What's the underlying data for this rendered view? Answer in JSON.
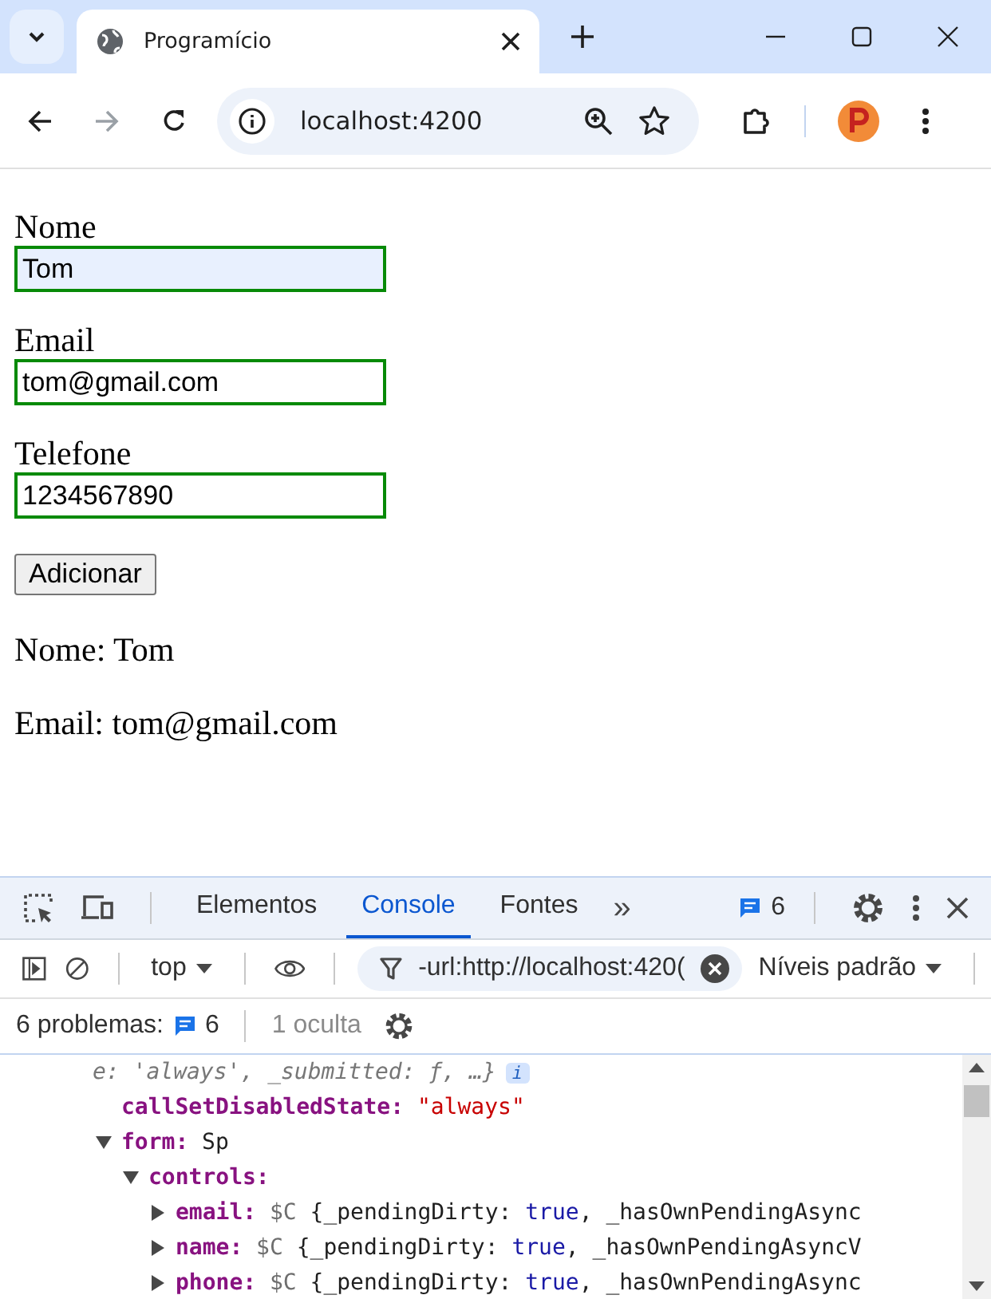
{
  "browser": {
    "tab_title": "Programício",
    "url": "localhost:4200"
  },
  "form": {
    "fields": [
      {
        "label": "Nome",
        "value": "Tom",
        "autofilled": true
      },
      {
        "label": "Email",
        "value": "tom@gmail.com",
        "autofilled": false
      },
      {
        "label": "Telefone",
        "value": "1234567890",
        "autofilled": false
      }
    ],
    "submit_button": "Adicionar",
    "results": [
      "Nome: Tom",
      "Email: tom@gmail.com"
    ]
  },
  "devtools": {
    "tabs": [
      {
        "label": "Elementos",
        "selected": false
      },
      {
        "label": "Console",
        "selected": true
      },
      {
        "label": "Fontes",
        "selected": false
      }
    ],
    "more_tabs": "»",
    "issues_count": "6",
    "context": "top",
    "filter": "-url:http://localhost:420(",
    "levels": "Níveis padrão",
    "problems_label": "6 problemas:",
    "problems_count": "6",
    "hidden": "1 oculta",
    "console": [
      {
        "kind": "summary",
        "text": "e: 'always', _submitted: ƒ, …}",
        "badge": "i"
      },
      {
        "kind": "prop",
        "key": "callSetDisabledState:",
        "value": "\"always\""
      },
      {
        "kind": "node",
        "key": "form:",
        "expanded": true,
        "segments": [
          {
            "kind": "plain",
            "t": "Sp"
          }
        ],
        "children": [
          {
            "kind": "node",
            "key": "controls:",
            "expanded": true,
            "children": [
              {
                "kind": "node",
                "key": "email:",
                "expanded": false,
                "segments": [
                  {
                    "kind": "type",
                    "t": "$C "
                  },
                  {
                    "kind": "plain",
                    "t": "{_pendingDirty: "
                  },
                  {
                    "kind": "bool",
                    "t": "true"
                  },
                  {
                    "kind": "plain",
                    "t": ", _hasOwnPendingAsync"
                  }
                ]
              },
              {
                "kind": "node",
                "key": "name:",
                "expanded": false,
                "segments": [
                  {
                    "kind": "type",
                    "t": "$C "
                  },
                  {
                    "kind": "plain",
                    "t": "{_pendingDirty: "
                  },
                  {
                    "kind": "bool",
                    "t": "true"
                  },
                  {
                    "kind": "plain",
                    "t": ", _hasOwnPendingAsyncV"
                  }
                ]
              },
              {
                "kind": "node",
                "key": "phone:",
                "expanded": false,
                "segments": [
                  {
                    "kind": "type",
                    "t": "$C "
                  },
                  {
                    "kind": "plain",
                    "t": "{_pendingDirty: "
                  },
                  {
                    "kind": "bool",
                    "t": "true"
                  },
                  {
                    "kind": "plain",
                    "t": ", _hasOwnPendingAsync"
                  }
                ]
              }
            ]
          }
        ]
      }
    ]
  }
}
